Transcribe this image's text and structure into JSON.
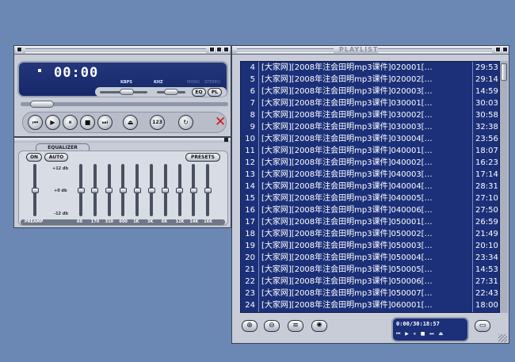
{
  "player": {
    "time": "00:00",
    "kbps_label": "KBPS",
    "khz_label": "KHZ",
    "mono_label": "MONO",
    "stereo_label": "STEREO",
    "eq_button": "EQ",
    "pl_button": "PL",
    "shuffle_label": "123",
    "seek_position": 0.05,
    "volume": 0.6,
    "balance": 0.5
  },
  "equalizer": {
    "title": "EQUALIZER",
    "on_label": "ON",
    "auto_label": "AUTO",
    "presets_label": "PRESETS",
    "db_top": "+12 db",
    "db_mid": "+0 db",
    "db_bottom": "-12 db",
    "preamp_label": "PREAMP",
    "preamp_level": 0.5,
    "bands": [
      {
        "freq": "60",
        "level": 0.5
      },
      {
        "freq": "170",
        "level": 0.5
      },
      {
        "freq": "310",
        "level": 0.5
      },
      {
        "freq": "600",
        "level": 0.5
      },
      {
        "freq": "1K",
        "level": 0.5
      },
      {
        "freq": "3K",
        "level": 0.5
      },
      {
        "freq": "6K",
        "level": 0.5
      },
      {
        "freq": "12K",
        "level": 0.5
      },
      {
        "freq": "14K",
        "level": 0.5
      },
      {
        "freq": "16K",
        "level": 0.5
      }
    ]
  },
  "playlist": {
    "title": "PLAYLIST",
    "items": [
      {
        "num": "4",
        "title": "[大家网][2008年注会田明mp3课件]020001[…",
        "duration": "29:53"
      },
      {
        "num": "5",
        "title": "[大家网][2008年注会田明mp3课件]020002[…",
        "duration": "29:14"
      },
      {
        "num": "6",
        "title": "[大家网][2008年注会田明mp3课件]020003[…",
        "duration": "14:59"
      },
      {
        "num": "7",
        "title": "[大家网][2008年注会田明mp3课件]030001[…",
        "duration": "30:03"
      },
      {
        "num": "8",
        "title": "[大家网][2008年注会田明mp3课件]030002[…",
        "duration": "30:58"
      },
      {
        "num": "9",
        "title": "[大家网][2008年注会田明mp3课件]030003[…",
        "duration": "32:38"
      },
      {
        "num": "10",
        "title": "[大家网][2008年注会田明mp3课件]030004[…",
        "duration": "23:56"
      },
      {
        "num": "11",
        "title": "[大家网][2008年注会田明mp3课件]040001[…",
        "duration": "18:07"
      },
      {
        "num": "12",
        "title": "[大家网][2008年注会田明mp3课件]040002[…",
        "duration": "16:23"
      },
      {
        "num": "13",
        "title": "[大家网][2008年注会田明mp3课件]040003[…",
        "duration": "17:14"
      },
      {
        "num": "14",
        "title": "[大家网][2008年注会田明mp3课件]040004[…",
        "duration": "28:31"
      },
      {
        "num": "15",
        "title": "[大家网][2008年注会田明mp3课件]040005[…",
        "duration": "27:10"
      },
      {
        "num": "16",
        "title": "[大家网][2008年注会田明mp3课件]040006[…",
        "duration": "27:50"
      },
      {
        "num": "17",
        "title": "[大家网][2008年注会田明mp3课件]050001[…",
        "duration": "26:59"
      },
      {
        "num": "18",
        "title": "[大家网][2008年注会田明mp3课件]050002[…",
        "duration": "21:49"
      },
      {
        "num": "19",
        "title": "[大家网][2008年注会田明mp3课件]050003[…",
        "duration": "20:10"
      },
      {
        "num": "20",
        "title": "[大家网][2008年注会田明mp3课件]050004[…",
        "duration": "23:34"
      },
      {
        "num": "21",
        "title": "[大家网][2008年注会田明mp3课件]050005[…",
        "duration": "14:53"
      },
      {
        "num": "22",
        "title": "[大家网][2008年注会田明mp3课件]050006[…",
        "duration": "27:31"
      },
      {
        "num": "23",
        "title": "[大家网][2008年注会田明mp3课件]050007[…",
        "duration": "22:43"
      },
      {
        "num": "24",
        "title": "[大家网][2008年注会田明mp3课件]060001[…",
        "duration": "18:00"
      }
    ],
    "mini_time": "0:00/30:18:57",
    "buttons": [
      {
        "name": "add-icon",
        "glyph": "⊕"
      },
      {
        "name": "remove-icon",
        "glyph": "⊖"
      },
      {
        "name": "select-icon",
        "glyph": "≡"
      },
      {
        "name": "misc-icon",
        "glyph": "✺"
      }
    ],
    "mini_controls": "⏮ ▶ ⏸ ■ ⏭ ⏏"
  },
  "colors": {
    "display_bg": "#1c3079",
    "skin": "#c7ccd6",
    "desktop": "#6b88b4",
    "close_red": "#d41414"
  }
}
